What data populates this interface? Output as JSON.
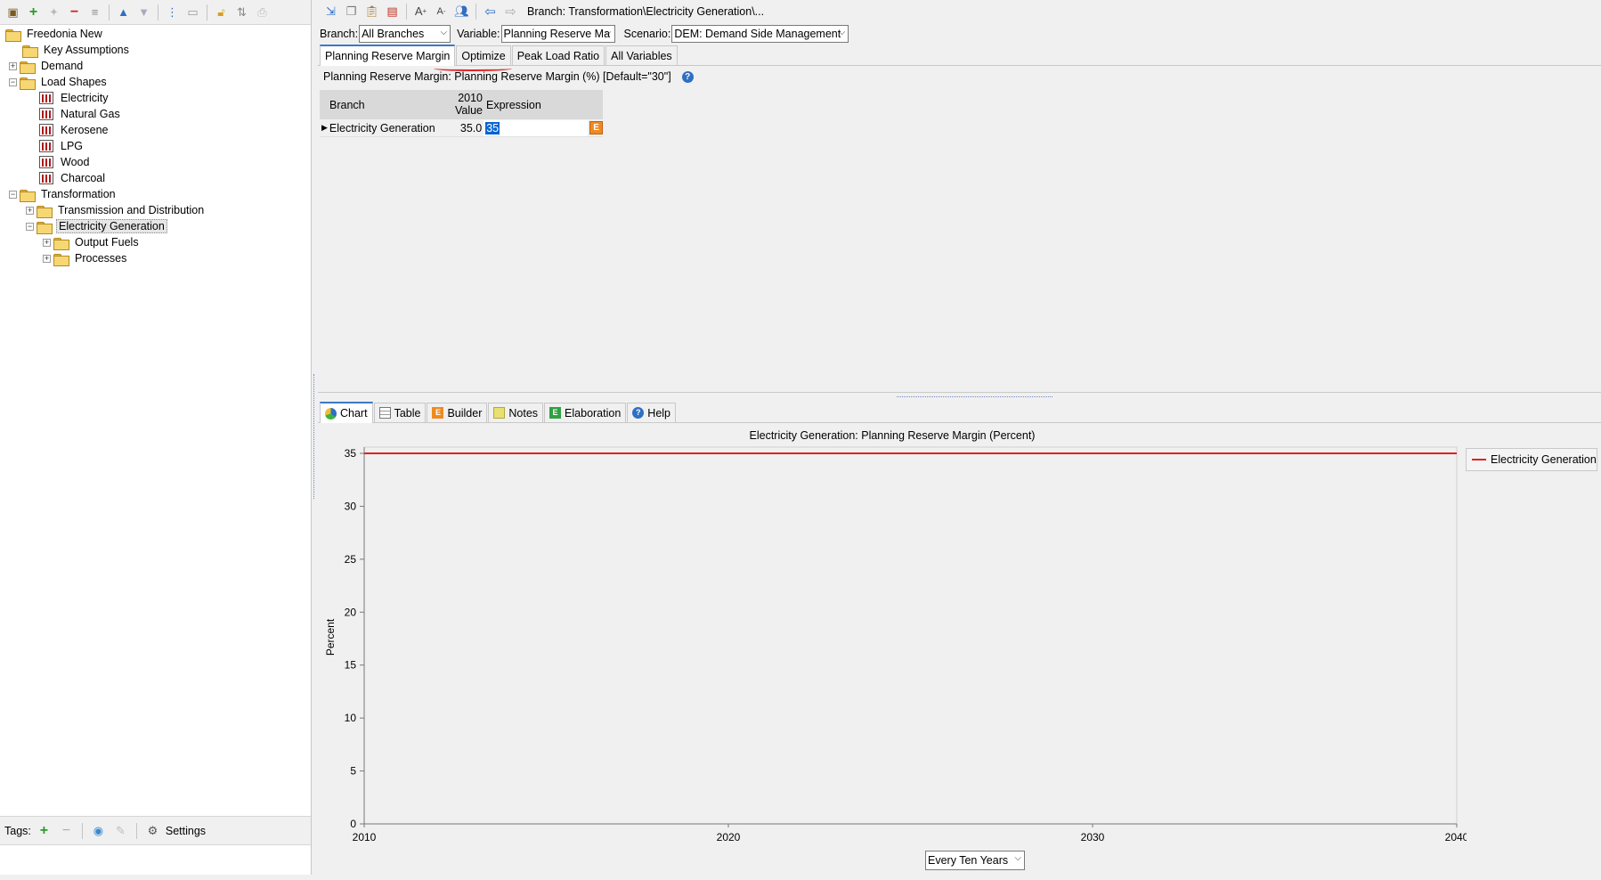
{
  "left_toolbar": {
    "icons": [
      "properties-icon",
      "add-icon",
      "add-disabled-icon",
      "remove-icon",
      "remove-all-icon",
      "move-up-icon",
      "move-down-icon",
      "tree-icon",
      "folder-icon",
      "lock-icon",
      "sort-icon",
      "print-icon"
    ]
  },
  "tree": {
    "root": "Freedonia New",
    "key_assumptions": "Key Assumptions",
    "demand": "Demand",
    "load_shapes": "Load Shapes",
    "load_shape_items": [
      "Electricity",
      "Natural Gas",
      "Kerosene",
      "LPG",
      "Wood",
      "Charcoal"
    ],
    "transformation": "Transformation",
    "transmission": "Transmission and Distribution",
    "electricity_generation": "Electricity Generation",
    "output_fuels": "Output Fuels",
    "processes": "Processes"
  },
  "tags": {
    "label": "Tags:",
    "settings_label": "Settings"
  },
  "breadcrumb": "Branch: Transformation\\Electricity Generation\\...",
  "selectors": {
    "branch_label": "Branch:",
    "branch_value": "All Branches",
    "variable_label": "Variable:",
    "variable_value": "Planning Reserve Ma",
    "scenario_label": "Scenario:",
    "scenario_value": "DEM: Demand Side Management"
  },
  "tabs": [
    "Planning Reserve Margin",
    "Optimize",
    "Peak Load Ratio",
    "All Variables"
  ],
  "variable_desc": "Planning Reserve Margin: Planning Reserve Margin (%) [Default=\"30\"]",
  "grid": {
    "col_branch": "Branch",
    "col_value_year": "2010",
    "col_value": "Value",
    "col_expression": "Expression",
    "row_branch": "Electricity Generation",
    "row_value": "35.0",
    "row_expression": "35",
    "expr_button": "E"
  },
  "bottom_tabs": [
    "Chart",
    "Table",
    "Builder",
    "Notes",
    "Elaboration",
    "Help"
  ],
  "interval_select": "Every Ten Years",
  "colors": {
    "series": "#e02020",
    "accent": "#3c78c8"
  },
  "chart_data": {
    "type": "line",
    "title": "Electricity Generation: Planning Reserve Margin (Percent)",
    "ylabel": "Percent",
    "xlabel": "",
    "x_ticks": [
      2010,
      2020,
      2030,
      2040
    ],
    "y_ticks": [
      0,
      5,
      10,
      15,
      20,
      25,
      30,
      35
    ],
    "xlim": [
      2010,
      2040
    ],
    "ylim": [
      0,
      35
    ],
    "series": [
      {
        "name": "Electricity Generation",
        "x": [
          2010,
          2040
        ],
        "values": [
          35,
          35
        ]
      }
    ],
    "legend": "right",
    "grid": false
  }
}
